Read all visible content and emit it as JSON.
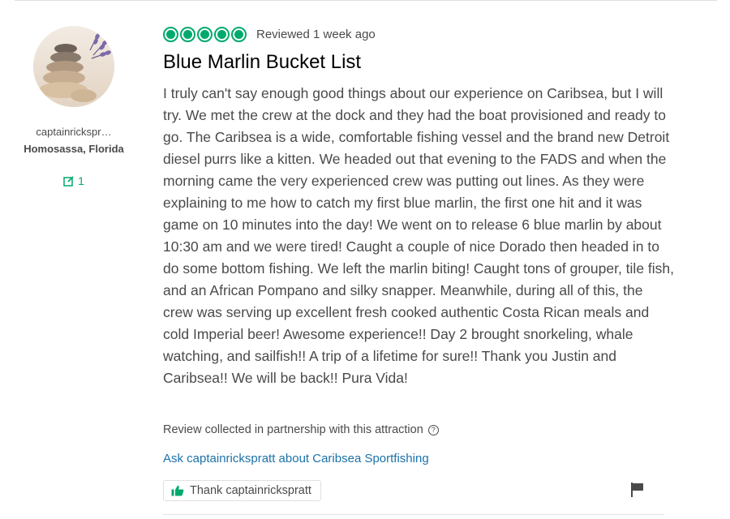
{
  "reviewer": {
    "username": "captainrickspr…",
    "location": "Homosassa, Florida",
    "contributions": "1",
    "avatar_icon": "stacked-stones-lavender-avatar",
    "contribution_icon": "pencil-square-icon"
  },
  "review": {
    "rating": 5,
    "rating_max": 5,
    "reviewed_text": "Reviewed 1 week ago",
    "title": "Blue Marlin Bucket List",
    "body": "I truly can't say enough good things about our experience on Caribsea, but I will try. We met the crew at the dock and they had the boat provisioned and ready to go. The Caribsea is a wide, comfortable fishing vessel and the brand new Detroit diesel purrs like a kitten. We headed out that evening to the FADS and when the morning came the very experienced crew was putting out lines. As they were explaining to me how to catch my first blue marlin, the first one hit and it was game on 10 minutes into the day! We went on to release 6 blue marlin by about 10:30 am and we were tired! Caught a couple of nice Dorado then headed in to do some bottom fishing. We left the marlin biting! Caught tons of grouper, tile fish, and an African Pompano and silky snapper. Meanwhile, during all of this, the crew was serving up excellent fresh cooked authentic Costa Rican meals and cold Imperial beer! Awesome experience!! Day 2 brought snorkeling, whale watching, and sailfish!! A trip of a lifetime for sure!! Thank you Justin and Caribsea!! We will be back!! Pura Vida!",
    "partnership_note": "Review collected in partnership with this attraction",
    "ask_link": "Ask captainrickspratt about Caribsea Sportfishing",
    "thank_button": "Thank captainrickspratt"
  },
  "colors": {
    "rating_green": "#00aa6c",
    "link_blue": "#1c72a8",
    "text_gray": "#4a4a4a",
    "title_black": "#000000",
    "divider": "#e0e0e0"
  }
}
